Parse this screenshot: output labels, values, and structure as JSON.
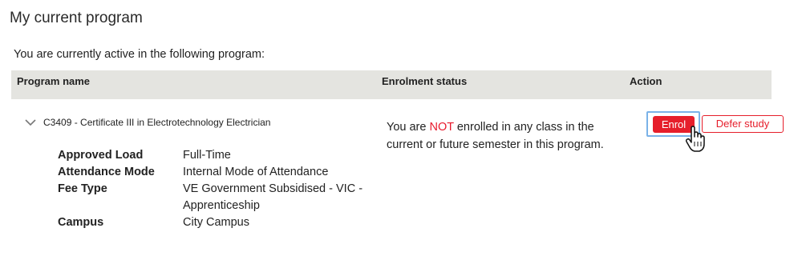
{
  "page": {
    "title": "My current program",
    "intro": "You are currently active in the following program:"
  },
  "table": {
    "headers": {
      "program_name": "Program name",
      "enrolment_status": "Enrolment status",
      "action": "Action"
    }
  },
  "program": {
    "name": "C3409 - Certificate III in Electrotechnology Electrician",
    "expand_icon": "chevron-down-icon",
    "details": [
      {
        "label": "Approved Load",
        "value": "Full-Time"
      },
      {
        "label": "Attendance Mode",
        "value": "Internal Mode of Attendance"
      },
      {
        "label": "Fee Type",
        "value": "VE Government Subsidised - VIC - Apprenticeship"
      },
      {
        "label": "Campus",
        "value": "City Campus"
      }
    ],
    "status": {
      "prefix": "You are ",
      "highlight": "NOT",
      "suffix": " enrolled in any class in the current or future semester in this program."
    },
    "actions": {
      "enrol_label": "Enrol",
      "defer_label": "Defer study"
    }
  },
  "colors": {
    "accent_red": "#e61e2b",
    "header_bg": "#e4e4e0",
    "focus_ring": "#7ab2e8"
  },
  "cursor_icon": "hand-pointer-icon"
}
